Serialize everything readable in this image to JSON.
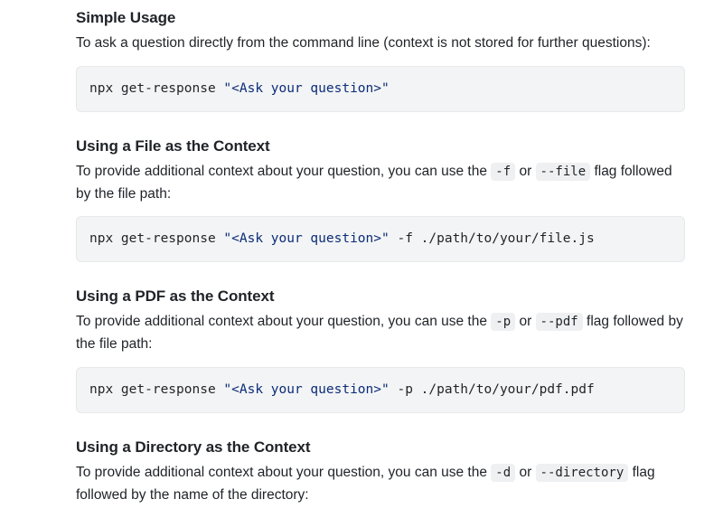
{
  "sections": [
    {
      "heading": "Simple Usage",
      "desc_parts": [
        "To ask a question directly from the command line (context is not stored for further questions):"
      ],
      "code": {
        "prefix": "npx get-response ",
        "question": "\"<Ask your question>\"",
        "suffix": ""
      }
    },
    {
      "heading": "Using a File as the Context",
      "desc_parts": [
        "To provide additional context about your question, you can use the ",
        "-f",
        " or ",
        "--file",
        " flag followed by the file path:"
      ],
      "code": {
        "prefix": "npx get-response ",
        "question": "\"<Ask your question>\"",
        "suffix": " -f ./path/to/your/file.js"
      }
    },
    {
      "heading": "Using a PDF as the Context",
      "desc_parts": [
        "To provide additional context about your question, you can use the ",
        "-p",
        " or ",
        "--pdf",
        " flag followed by the file path:"
      ],
      "code": {
        "prefix": "npx get-response ",
        "question": "\"<Ask your question>\"",
        "suffix": " -p ./path/to/your/pdf.pdf"
      }
    },
    {
      "heading": "Using a Directory as the Context",
      "desc_parts": [
        "To provide additional context about your question, you can use the ",
        "-d",
        " or ",
        "--directory",
        " flag followed by the name of the directory:"
      ],
      "code": null
    }
  ]
}
